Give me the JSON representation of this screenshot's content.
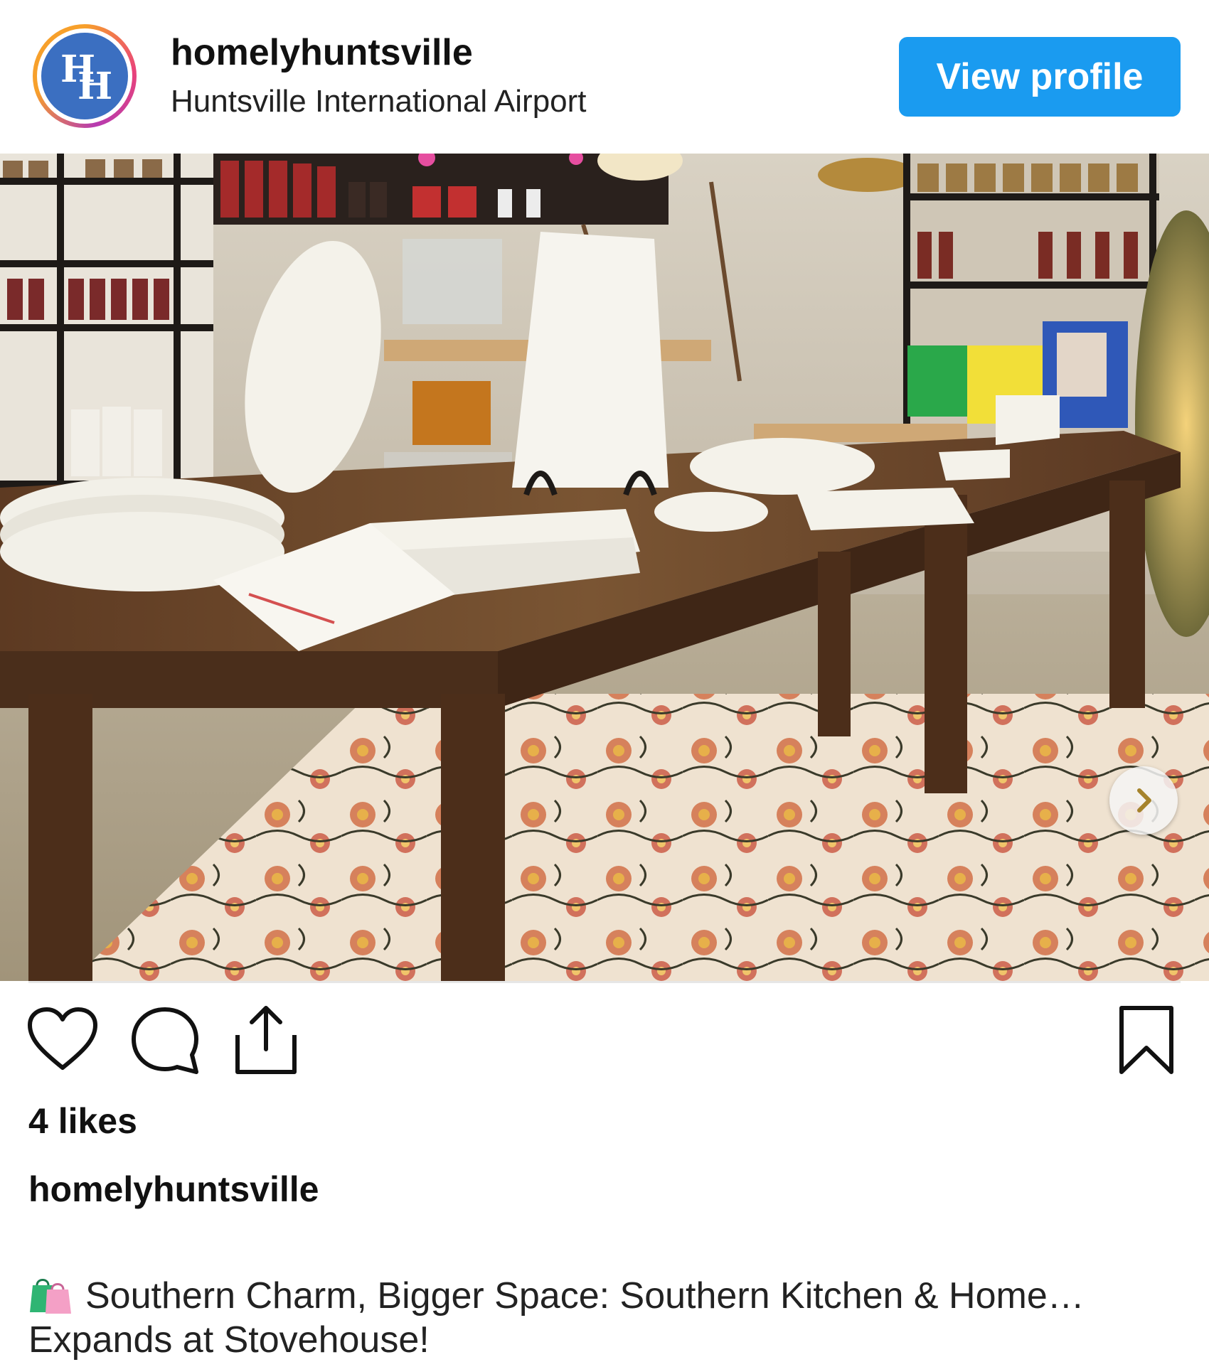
{
  "post": {
    "account_name": "homelyhuntsville",
    "location": "Huntsville International Airport",
    "view_profile_label": "View profile",
    "avatar_monogram": "HH",
    "likes_text": "4 likes",
    "caption_username": "homelyhuntsville",
    "caption_line1": "Southern Charm, Bigger Space: Southern Kitchen & Home…",
    "caption_line2": "Expands at Stovehouse!"
  },
  "icons": {
    "like": "heart-icon",
    "comment": "comment-bubble-icon",
    "share": "share-upload-icon",
    "save": "bookmark-icon",
    "next": "chevron-right-icon",
    "caption_emoji": "shopping-bags-emoji"
  },
  "colors": {
    "accent_button": "#1a9bf0",
    "avatar_blue": "#3b6fc1",
    "next_chevron": "#a5832c"
  }
}
